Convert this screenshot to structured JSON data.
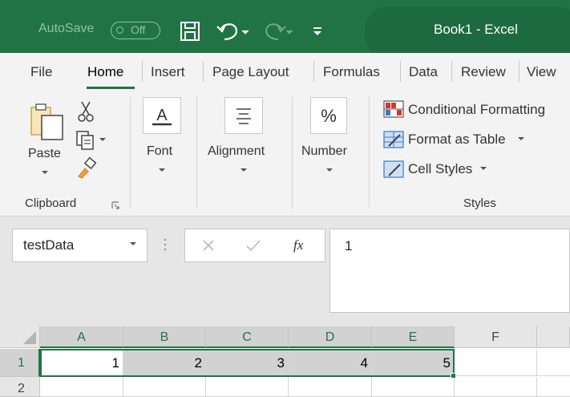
{
  "titlebar": {
    "autosave_label": "AutoSave",
    "autosave_state": "Off",
    "title": "Book1  -  Excel"
  },
  "tabs": [
    "File",
    "Home",
    "Insert",
    "Page Layout",
    "Formulas",
    "Data",
    "Review",
    "View"
  ],
  "active_tab": "Home",
  "ribbon": {
    "clipboard": {
      "paste_label": "Paste",
      "group_label": "Clipboard"
    },
    "font": {
      "label": "Font"
    },
    "alignment": {
      "label": "Alignment"
    },
    "number": {
      "label": "Number"
    },
    "styles": {
      "conditional_formatting": "Conditional Formatting",
      "format_as_table": "Format as Table",
      "cell_styles": "Cell Styles",
      "group_label": "Styles"
    }
  },
  "formula_bar": {
    "name_box": "testData",
    "fx_label": "fx",
    "formula_value": "1"
  },
  "grid": {
    "columns": [
      "A",
      "B",
      "C",
      "D",
      "E",
      "F"
    ],
    "rows": [
      "1",
      "2"
    ],
    "row1_values": [
      "1",
      "2",
      "3",
      "4",
      "5",
      ""
    ]
  },
  "colors": {
    "accent": "#217346",
    "selection_fill": "#d2d2d2"
  }
}
